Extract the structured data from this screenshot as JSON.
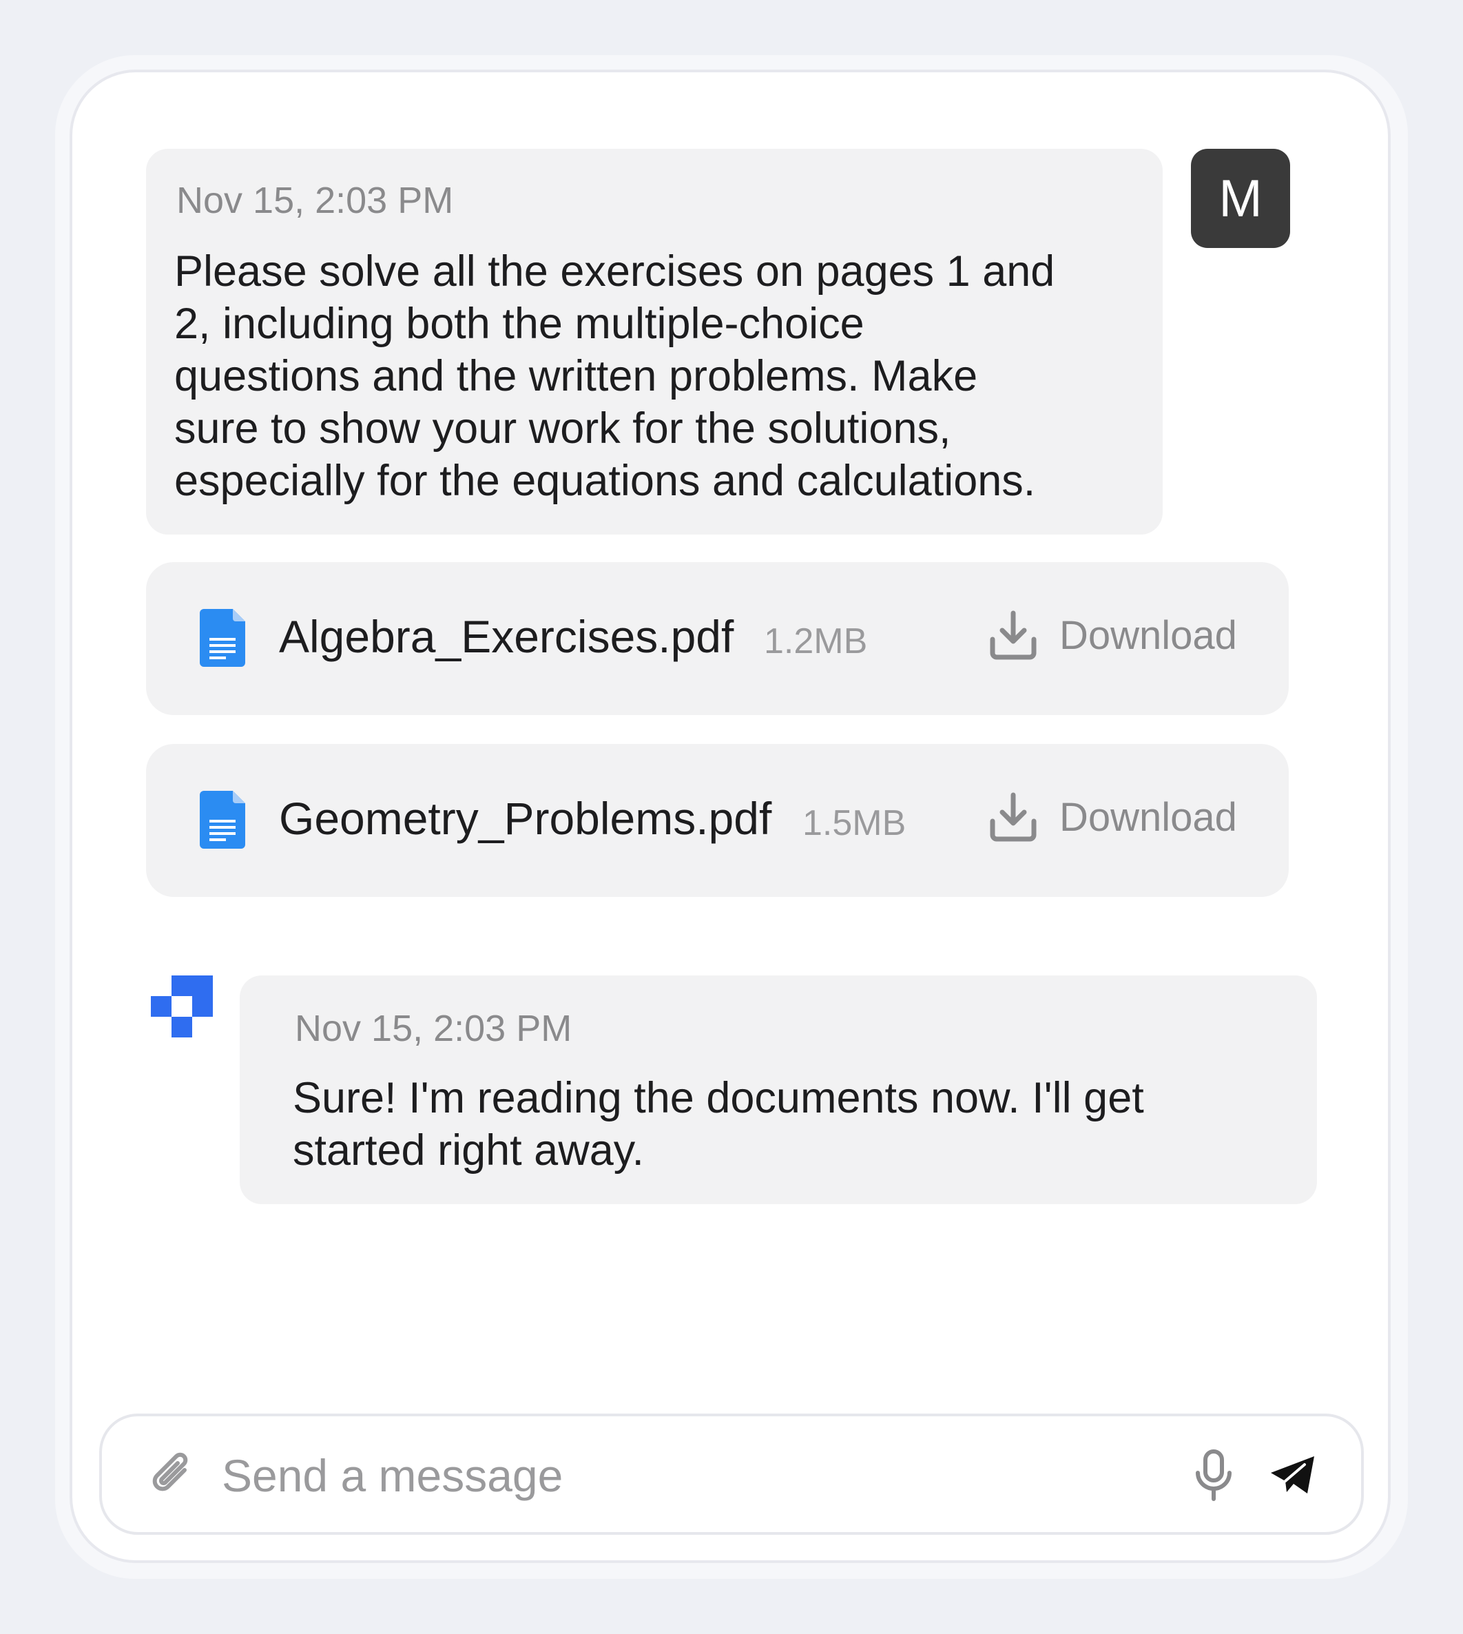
{
  "user_message": {
    "avatar_initial": "M",
    "timestamp": "Nov 15, 2:03 PM",
    "text_lines": [
      "Please solve all the exercises on pages 1 and",
      "2, including both the multiple-choice",
      "questions and the written problems. Make",
      "sure to show your work for the solutions,",
      "especially for the equations and calculations."
    ]
  },
  "attachments": [
    {
      "name": "Algebra_Exercises.pdf",
      "size": "1.2MB",
      "action_label": "Download",
      "icon": "document-icon"
    },
    {
      "name": "Geometry_Problems.pdf",
      "size": "1.5MB",
      "action_label": "Download",
      "icon": "document-icon"
    }
  ],
  "bot_message": {
    "timestamp": "Nov 15, 2:03 PM",
    "text_lines": [
      "Sure! I'm reading the documents now. I'll get",
      "started right away."
    ]
  },
  "composer": {
    "placeholder": "Send a message",
    "value": "",
    "icons": [
      "paperclip-icon",
      "microphone-icon",
      "send-icon"
    ]
  },
  "colors": {
    "accent_blue": "#2f6df0",
    "doc_blue": "#2b8cf2",
    "avatar_bg": "#3a3a3a",
    "bubble_bg": "#f2f2f3"
  }
}
